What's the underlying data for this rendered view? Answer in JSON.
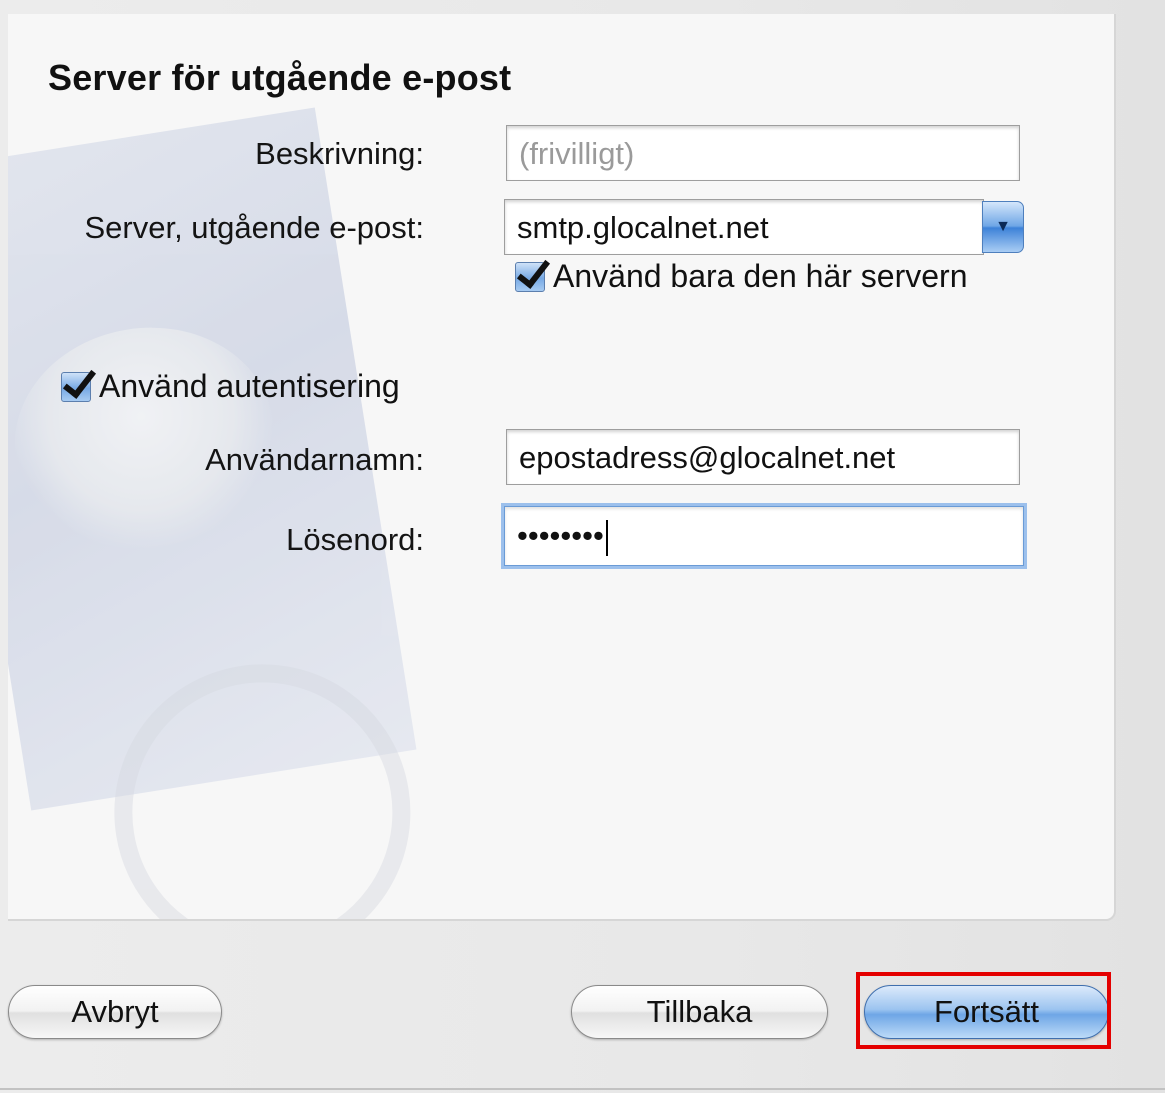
{
  "title": "Server för utgående e-post",
  "fields": {
    "description": {
      "label": "Beskrivning:",
      "placeholder": "(frivilligt)",
      "value": ""
    },
    "server": {
      "label": "Server, utgående e-post:",
      "value": "smtp.glocalnet.net"
    },
    "username": {
      "label": "Användarnamn:",
      "value": "epostadress@glocalnet.net"
    },
    "password": {
      "label": "Lösenord:",
      "masked_value": "••••••••"
    }
  },
  "checkboxes": {
    "only_this_server": {
      "label": "Använd bara den här servern",
      "checked": true
    },
    "use_authentication": {
      "label": "Använd autentisering",
      "checked": true
    }
  },
  "buttons": {
    "cancel": "Avbryt",
    "back": "Tillbaka",
    "continue": "Fortsätt"
  },
  "colors": {
    "highlight": "#e40000",
    "focus_ring": "#9cc0ec",
    "accent": "#6ea6e6"
  },
  "icons": {
    "combo_arrow": "chevron-down-icon",
    "checkmark": "checkmark-icon"
  }
}
